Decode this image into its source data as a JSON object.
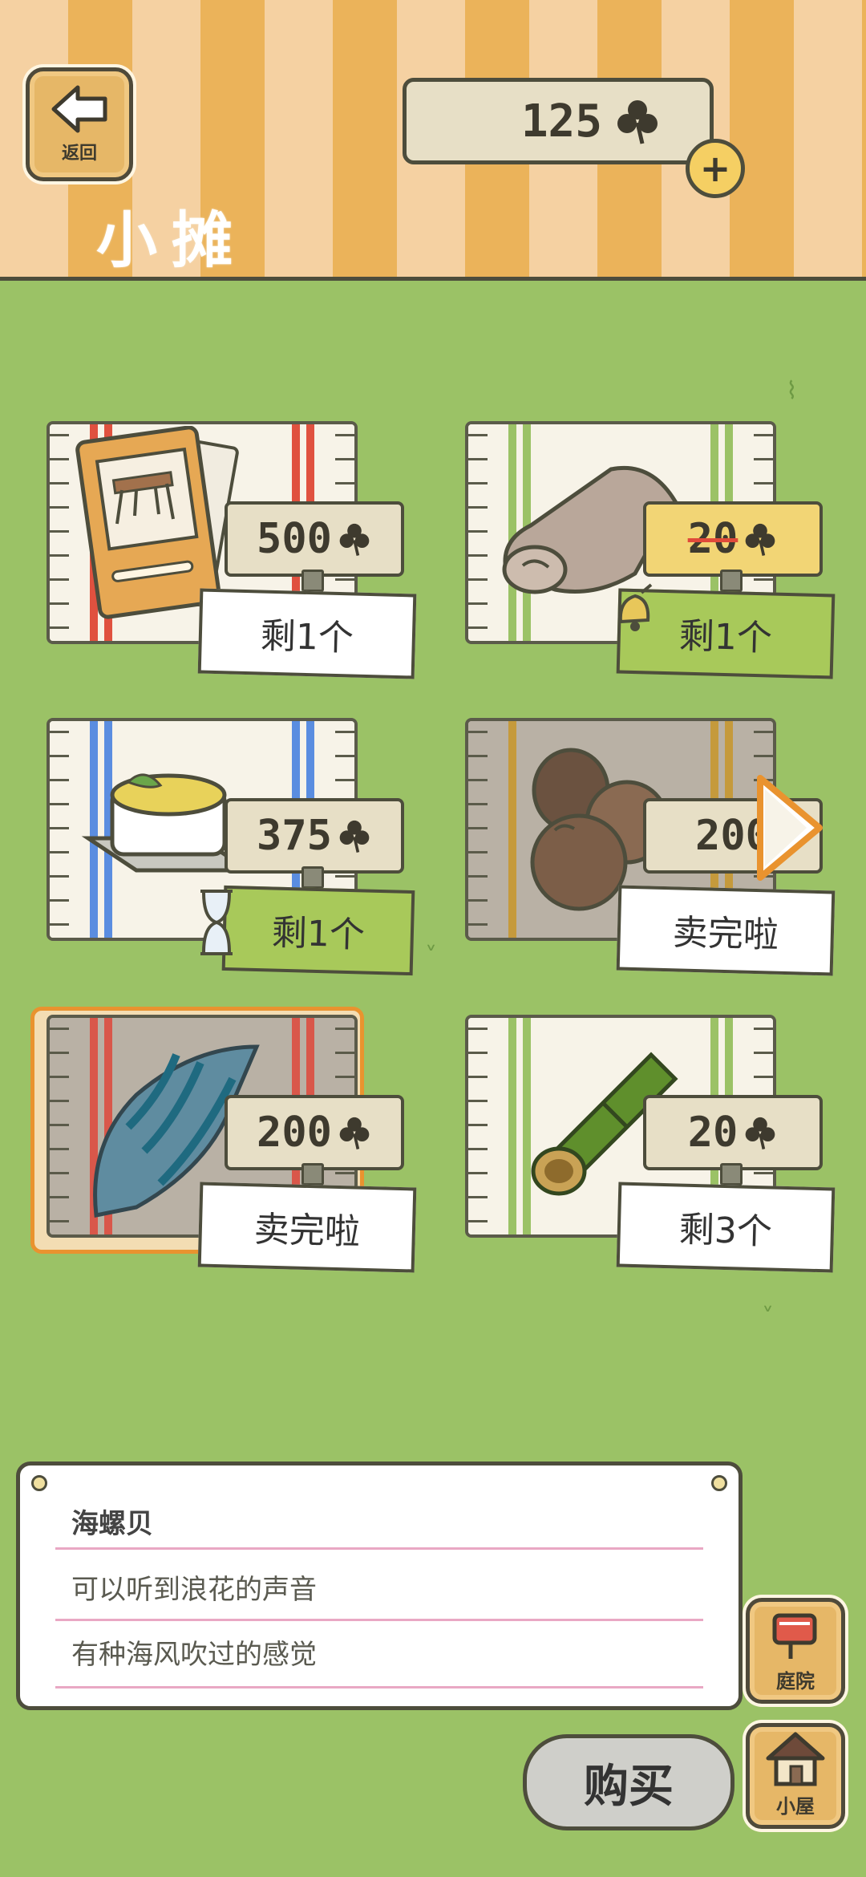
{
  "header": {
    "back_label": "返回",
    "title": "小摊",
    "currency_amount": "125",
    "plus_label": "+"
  },
  "items": [
    {
      "price": "500",
      "status": "剩1个",
      "stripe_color": "#e0513f"
    },
    {
      "price": "20",
      "status": "剩1个",
      "stripe_color": "#9bc266",
      "on_sale": true
    },
    {
      "price": "375",
      "status": "剩1个",
      "stripe_color": "#5a8de0"
    },
    {
      "price": "200",
      "status": "卖完啦",
      "stripe_color": "#c59a3c"
    },
    {
      "price": "200",
      "status": "卖完啦",
      "stripe_color": "#e0513f"
    },
    {
      "price": "20",
      "status": "剩3个",
      "stripe_color": "#9bc266"
    }
  ],
  "description": {
    "name": "海螺贝",
    "line1": "可以听到浪花的声音",
    "line2": "有种海风吹过的感觉"
  },
  "side_buttons": {
    "yard_label": "庭院",
    "house_label": "小屋"
  },
  "buy_label": "购买",
  "colors": {
    "grass": "#9bc266",
    "accent_orange": "#e9932f",
    "wood": "#e6b767"
  }
}
